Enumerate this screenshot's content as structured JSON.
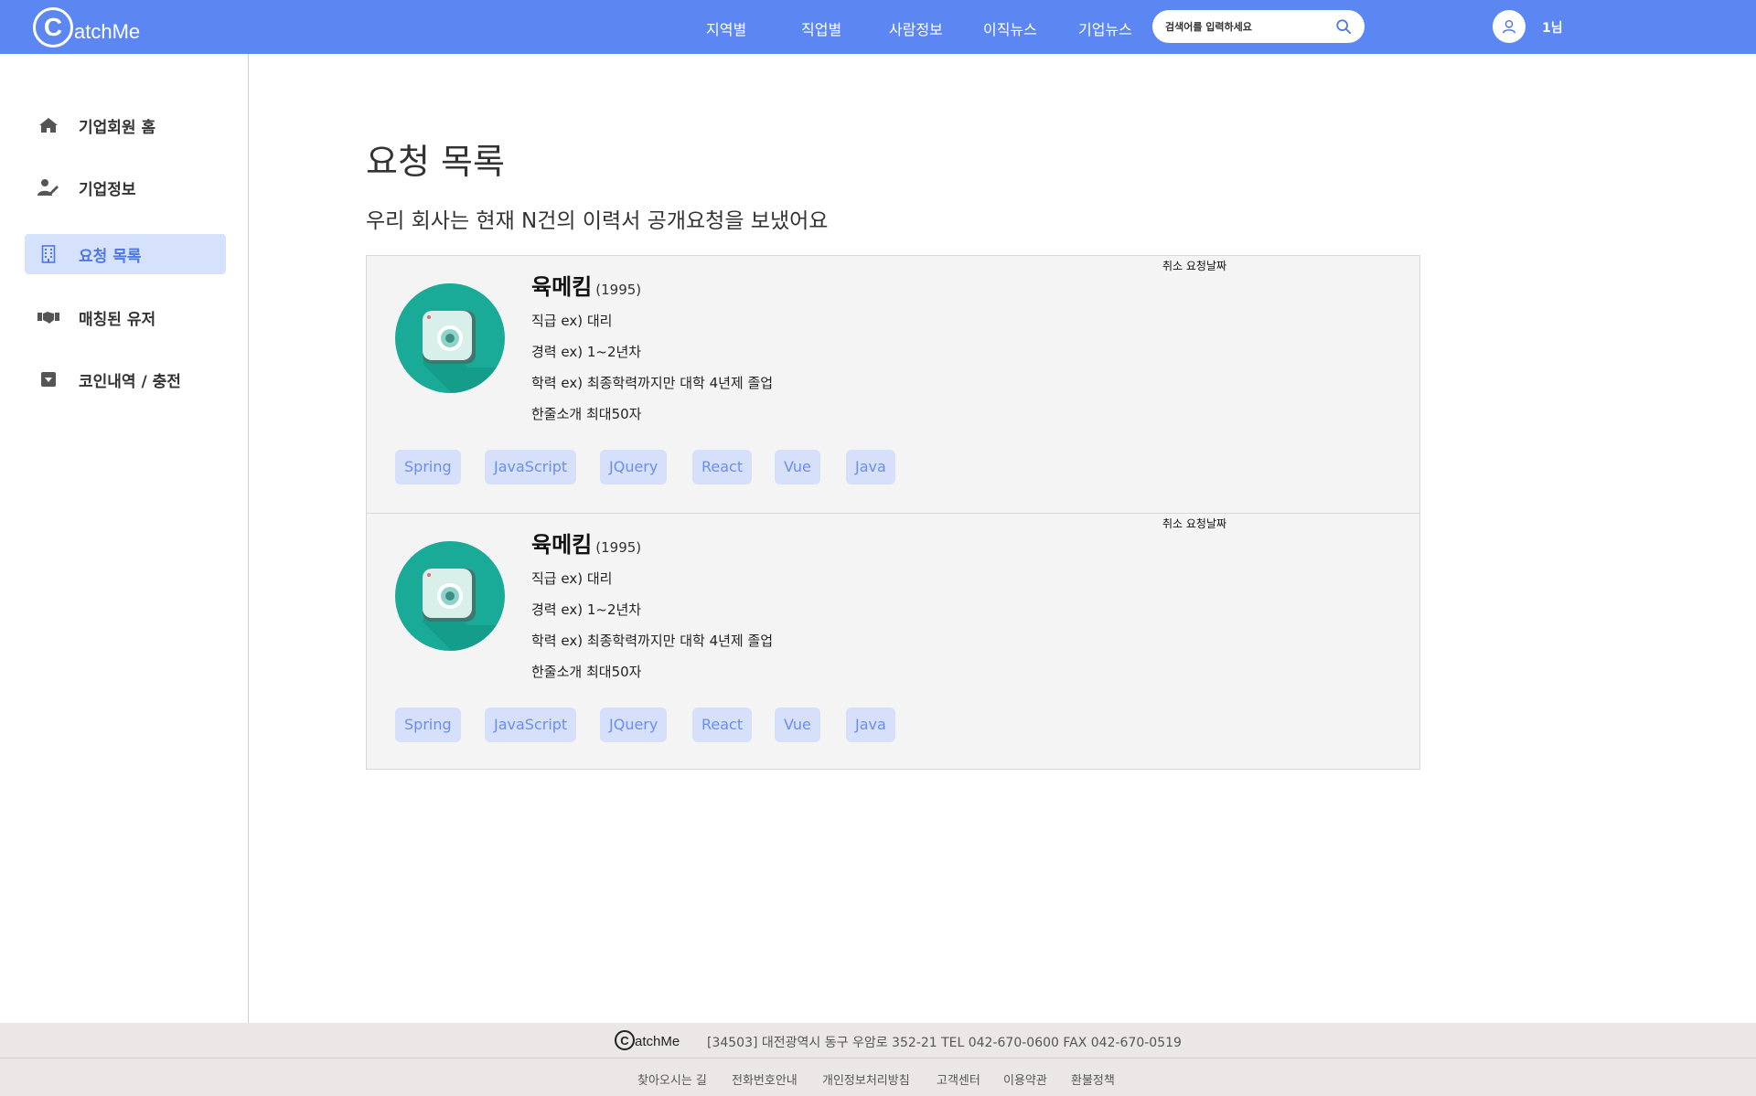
{
  "header": {
    "logo_letter": "C",
    "logo_text": "atchMe",
    "nav": [
      "지역별",
      "직업별",
      "사람정보",
      "이직뉴스",
      "기업뉴스"
    ],
    "search_placeholder": "검색어를 입력하세요",
    "user_name": "1님"
  },
  "sidebar": {
    "items": [
      {
        "label": "기업회원 홈",
        "icon": "home-icon",
        "active": false
      },
      {
        "label": "기업정보",
        "icon": "user-edit-icon",
        "active": false
      },
      {
        "label": "요청 목록",
        "icon": "building-icon",
        "active": true
      },
      {
        "label": "매칭된 유저",
        "icon": "handshake-icon",
        "active": false
      },
      {
        "label": "코인내역 / 충전",
        "icon": "caret-square-down-icon",
        "active": false
      }
    ]
  },
  "main": {
    "title": "요청 목록",
    "subtitle": "우리 회사는 현재 N건의 이력서 공개요청을 보냈어요",
    "cards": [
      {
        "name": "육메킴",
        "year": "(1995)",
        "position": "직급 ex) 대리",
        "career": "경력 ex) 1~2년차",
        "education": "학력 ex) 최종학력까지만 대학 4년제 졸업",
        "intro": "한줄소개 최대50자",
        "cancel": "취소 요청날짜",
        "tags": [
          "Spring",
          "JavaScript",
          "JQuery",
          "React",
          "Vue",
          "Java"
        ]
      },
      {
        "name": "육메킴",
        "year": "(1995)",
        "position": "직급 ex) 대리",
        "career": "경력 ex) 1~2년차",
        "education": "학력 ex) 최종학력까지만 대학 4년제 졸업",
        "intro": "한줄소개 최대50자",
        "cancel": "취소 요청날짜",
        "tags": [
          "Spring",
          "JavaScript",
          "JQuery",
          "React",
          "Vue",
          "Java"
        ]
      }
    ]
  },
  "footer": {
    "logo_letter": "C",
    "logo_text": "atchMe",
    "address": "[34503] 대전광역시 동구 우암로 352-21 TEL 042-670-0600 FAX 042-670-0519",
    "links": [
      "찾아오시는 길",
      "전화번호안내",
      "개인정보처리방침",
      "고객센터",
      "이용약관",
      "환불정책"
    ]
  },
  "colors": {
    "header_bg": "#5c87f2",
    "sidebar_active_bg": "#d6e1fb",
    "tag_bg": "#d6e0fb",
    "tag_text": "#6a8ef0",
    "avatar_bg": "#1aab98",
    "footer_bg": "#ebe7e7"
  }
}
